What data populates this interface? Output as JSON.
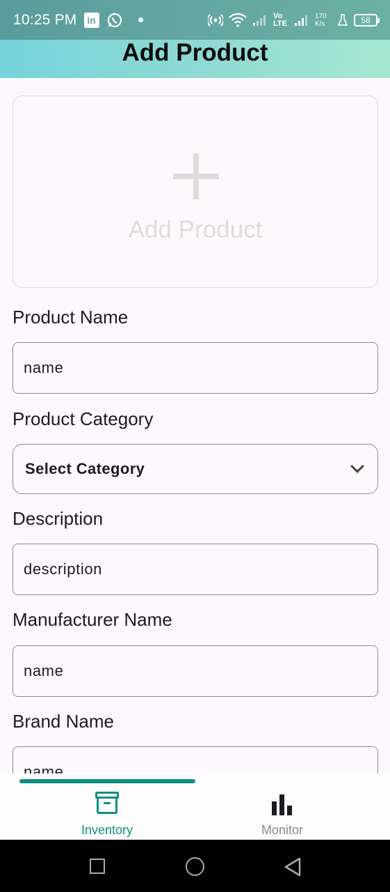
{
  "status_bar": {
    "time": "10:25 PM",
    "left_icons": [
      "linkedin-icon",
      "whatsapp-icon"
    ],
    "network_speed": "170 K/s",
    "network_type": "Vo LTE",
    "battery_level": "58"
  },
  "header": {
    "title": "Add Product"
  },
  "upload": {
    "label": "Add Product",
    "icon": "plus-icon"
  },
  "form": {
    "product_name": {
      "label": "Product Name",
      "value": "name"
    },
    "product_category": {
      "label": "Product Category",
      "selected": "Select Category"
    },
    "description": {
      "label": "Description",
      "value": "description"
    },
    "manufacturer_name": {
      "label": "Manufacturer Name",
      "value": "name"
    },
    "brand_name": {
      "label": "Brand Name",
      "value": "name"
    }
  },
  "bottom_nav": {
    "items": [
      {
        "label": "Inventory",
        "icon": "archive-icon",
        "active": true
      },
      {
        "label": "Monitor",
        "icon": "bar-chart-icon",
        "active": false
      }
    ]
  },
  "colors": {
    "accent": "#138f85",
    "gradient_start": "#76d4dc",
    "gradient_end": "#a5e8d1",
    "background": "#fdf8fc"
  }
}
